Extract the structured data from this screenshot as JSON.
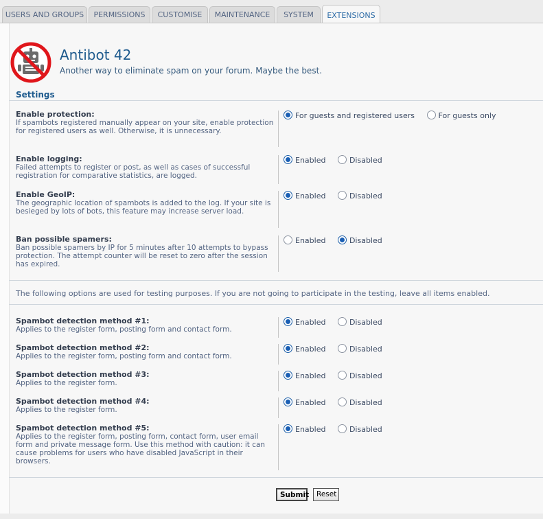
{
  "tabs": [
    {
      "label": "USERS AND GROUPS",
      "active": false
    },
    {
      "label": "PERMISSIONS",
      "active": false
    },
    {
      "label": "CUSTOMISE",
      "active": false
    },
    {
      "label": "MAINTENANCE",
      "active": false
    },
    {
      "label": "SYSTEM",
      "active": false
    },
    {
      "label": "EXTENSIONS",
      "active": true
    }
  ],
  "header": {
    "title": "Antibot 42",
    "subtitle": "Another way to eliminate spam on your forum. Maybe the best.",
    "logo_icon": "no-robot-icon"
  },
  "settings": {
    "legend": "Settings",
    "rows": [
      {
        "title": "Enable protection:",
        "desc": "If spambots registered manually appear on your site, enable protection for registered users as well. Otherwise, it is unnecessary.",
        "options": [
          "For guests and registered users",
          "For guests only"
        ],
        "selected": 0
      },
      {
        "title": "Enable logging:",
        "desc": "Failed attempts to register or post, as well as cases of successful registration for comparative statistics, are logged.",
        "options": [
          "Enabled",
          "Disabled"
        ],
        "selected": 0
      },
      {
        "title": "Enable GeoIP:",
        "desc": "The geographic location of spambots is added to the log. If your site is besieged by lots of bots, this feature may increase server load.",
        "options": [
          "Enabled",
          "Disabled"
        ],
        "selected": 0
      },
      {
        "title": "Ban possible spamers:",
        "desc": "Ban possible spamers by IP for 5 minutes after 10 attempts to bypass protection. The attempt counter will be reset to zero after the session has expired.",
        "options": [
          "Enabled",
          "Disabled"
        ],
        "selected": 1
      }
    ],
    "testing_note": "The following options are used for testing purposes. If you are not going to participate in the testing, leave all items enabled.",
    "methods": [
      {
        "title": "Spambot detection method #1:",
        "desc": "Applies to the register form, posting form and contact form.",
        "options": [
          "Enabled",
          "Disabled"
        ],
        "selected": 0
      },
      {
        "title": "Spambot detection method #2:",
        "desc": "Applies to the register form, posting form and contact form.",
        "options": [
          "Enabled",
          "Disabled"
        ],
        "selected": 0
      },
      {
        "title": "Spambot detection method #3:",
        "desc": "Applies to the register form.",
        "options": [
          "Enabled",
          "Disabled"
        ],
        "selected": 0
      },
      {
        "title": "Spambot detection method #4:",
        "desc": "Applies to the register form.",
        "options": [
          "Enabled",
          "Disabled"
        ],
        "selected": 0
      },
      {
        "title": "Spambot detection method #5:",
        "desc": "Applies to the register form, posting form, contact form, user email form and private message form. Use this method with caution: it can cause problems for users who have disabled JavaScript in their browsers.",
        "options": [
          "Enabled",
          "Disabled"
        ],
        "selected": 0
      }
    ]
  },
  "buttons": {
    "submit": "Submit",
    "reset": "Reset"
  },
  "colors": {
    "accent": "#1f5b8e",
    "text": "#536482",
    "logo_red": "#e0161b"
  }
}
